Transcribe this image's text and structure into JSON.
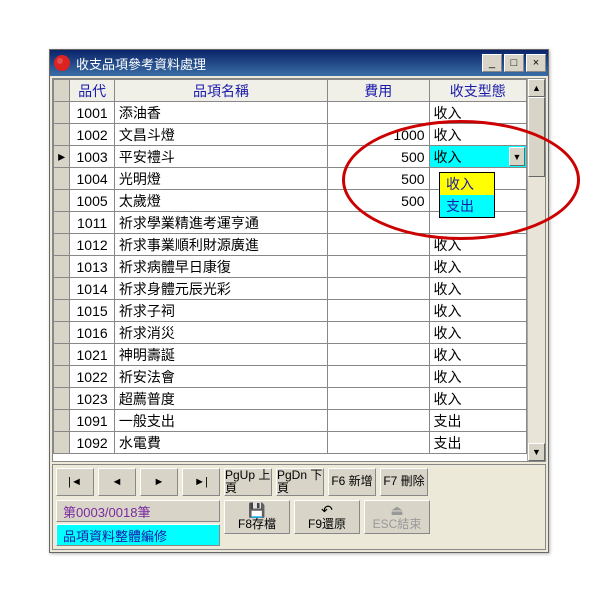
{
  "window": {
    "title": "收支品項參考資料處理"
  },
  "grid": {
    "headers": {
      "id": "品代",
      "name": "品項名稱",
      "fee": "費用",
      "type": "收支型態"
    },
    "rows": [
      {
        "id": "1001",
        "name": "添油香",
        "fee": "",
        "type": "收入",
        "sel": false
      },
      {
        "id": "1002",
        "name": "文昌斗燈",
        "fee": "1000",
        "type": "收入",
        "sel": false
      },
      {
        "id": "1003",
        "name": "平安禮斗",
        "fee": "500",
        "type": "收入",
        "sel": true,
        "combo": true
      },
      {
        "id": "1004",
        "name": "光明燈",
        "fee": "500",
        "type": "",
        "sel": false
      },
      {
        "id": "1005",
        "name": "太歲燈",
        "fee": "500",
        "type": "",
        "sel": false
      },
      {
        "id": "1011",
        "name": "祈求學業精進考運亨通",
        "fee": "",
        "type": "",
        "sel": false
      },
      {
        "id": "1012",
        "name": "祈求事業順利財源廣進",
        "fee": "",
        "type": "收入",
        "sel": false
      },
      {
        "id": "1013",
        "name": "祈求病體早日康復",
        "fee": "",
        "type": "收入",
        "sel": false
      },
      {
        "id": "1014",
        "name": "祈求身體元辰光彩",
        "fee": "",
        "type": "收入",
        "sel": false
      },
      {
        "id": "1015",
        "name": "祈求子祠",
        "fee": "",
        "type": "收入",
        "sel": false
      },
      {
        "id": "1016",
        "name": "祈求消災",
        "fee": "",
        "type": "收入",
        "sel": false
      },
      {
        "id": "1021",
        "name": "神明壽誕",
        "fee": "",
        "type": "收入",
        "sel": false
      },
      {
        "id": "1022",
        "name": "祈安法會",
        "fee": "",
        "type": "收入",
        "sel": false
      },
      {
        "id": "1023",
        "name": "超薦普度",
        "fee": "",
        "type": "收入",
        "sel": false
      },
      {
        "id": "1091",
        "name": "一般支出",
        "fee": "",
        "type": "支出",
        "sel": false
      },
      {
        "id": "1092",
        "name": "水電費",
        "fee": "",
        "type": "支出",
        "sel": false
      }
    ],
    "dropdown": {
      "items": [
        {
          "label": "收入",
          "selected": true
        },
        {
          "label": "支出",
          "selected": false
        }
      ]
    }
  },
  "toolbar": {
    "pgup": "PgUp\n上頁",
    "pgdn": "PgDn\n下頁",
    "f6": "F6\n新增",
    "f7": "F7\n刪除",
    "f8": "F8存檔",
    "f9": "F9還原",
    "esc": "ESC結束"
  },
  "status": {
    "counter": "第0003/0018筆",
    "editmode": "品項資料整體編修"
  }
}
